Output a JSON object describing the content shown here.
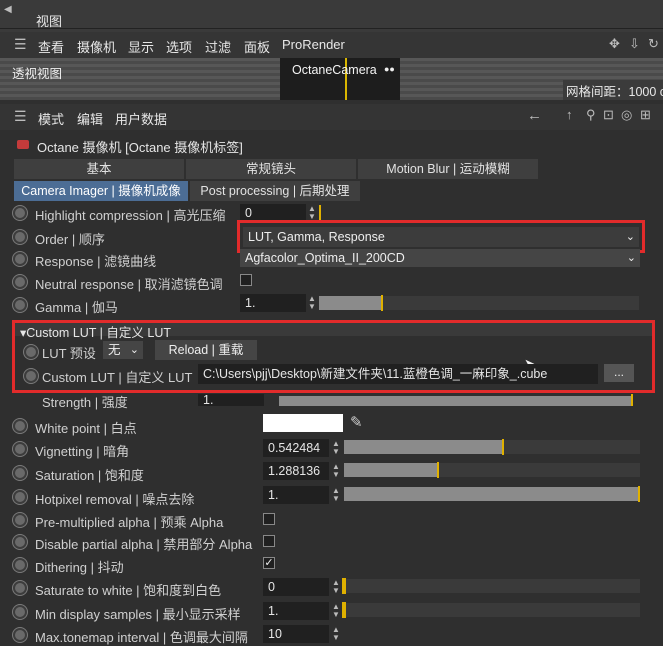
{
  "window": {
    "title": "视图"
  },
  "menu": {
    "items": [
      "查看",
      "摄像机",
      "显示",
      "选项",
      "过滤",
      "面板",
      "ProRender"
    ]
  },
  "viewport": {
    "label": "透视视图",
    "camera_name": "OctaneCamera",
    "grid_label": "网格间距：1000 c"
  },
  "attr_menu": {
    "items": [
      "模式",
      "编辑",
      "用户数据"
    ]
  },
  "object": {
    "title": "Octane 摄像机 [Octane 摄像机标签]"
  },
  "tabs_row1": [
    "基本",
    "常规镜头",
    "Motion Blur | 运动模糊"
  ],
  "tabs_row2": [
    "Camera Imager | 摄像机成像",
    "Post processing | 后期处理"
  ],
  "params": {
    "highlight": {
      "label": "Highlight compression | 高光压缩",
      "value": "0"
    },
    "order": {
      "label": "Order | 顺序",
      "value": "LUT, Gamma, Response"
    },
    "response": {
      "label": "Response | 滤镜曲线",
      "value": "Agfacolor_Optima_II_200CD"
    },
    "neutral": {
      "label": "Neutral response | 取消滤镜色调"
    },
    "gamma": {
      "label": "Gamma | 伽马",
      "value": "1.",
      "level": 0.2
    }
  },
  "custom_lut": {
    "section_title": "Custom LUT | 自定义 LUT",
    "preset_label": "LUT 预设",
    "preset_value": "无",
    "reload_label": "Reload | 重载",
    "path_label": "Custom LUT | 自定义 LUT",
    "path_value": "C:\\Users\\pjj\\Desktop\\新建文件夹\\11.蓝橙色调_一麻印象_.cube",
    "browse_label": "...",
    "strength_label": "Strength | 强度",
    "strength_value": "1."
  },
  "params2": {
    "white_point": {
      "label": "White point | 白点"
    },
    "vignetting": {
      "label": "Vignetting | 暗角",
      "value": "0.542484",
      "level": 0.54
    },
    "saturation": {
      "label": "Saturation | 饱和度",
      "value": "1.288136",
      "level": 0.32
    },
    "hotpixel": {
      "label": "Hotpixel removal | 噪点去除",
      "value": "1.",
      "level": 1.0
    },
    "premult": {
      "label": "Pre-multiplied alpha | 预乘 Alpha"
    },
    "disable_partial": {
      "label": "Disable partial alpha | 禁用部分 Alpha"
    },
    "dithering": {
      "label": "Dithering | 抖动"
    },
    "sat_white": {
      "label": "Saturate to white | 饱和度到白色",
      "value": "0",
      "level": 0.0
    },
    "min_samples": {
      "label": "Min display samples | 最小显示采样",
      "value": "1.",
      "level": 0.0
    },
    "max_tonemap": {
      "label": "Max.tonemap interval | 色调最大间隔",
      "value": "10"
    }
  },
  "colors": {
    "accent_tab": "#4c6d95",
    "highlight_box": "#e22b2b",
    "slider_marker": "#e0b100"
  }
}
